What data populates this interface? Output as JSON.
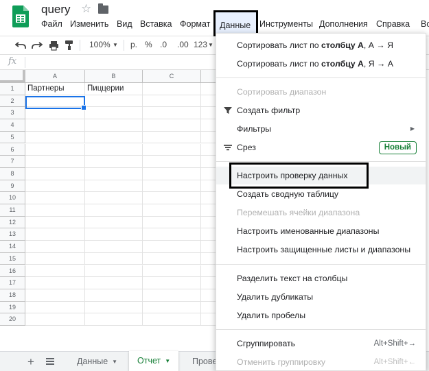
{
  "doc": {
    "title": "query",
    "star_icon": "star-icon",
    "folder_icon": "folder-icon"
  },
  "menubar": {
    "file": "Файл",
    "edit": "Изменить",
    "view": "Вид",
    "insert": "Вставка",
    "format": "Формат",
    "data": "Данные",
    "tools": "Инструменты",
    "addons": "Дополнения",
    "help": "Справка",
    "edge": "Вс"
  },
  "toolbar": {
    "zoom": "100%",
    "currency": "р.",
    "percent": "%",
    "dec_decrease": ".0",
    "dec_increase": ".00",
    "more_formats": "123"
  },
  "formula": {
    "fx": "fx"
  },
  "grid": {
    "columns": [
      "A",
      "B",
      "C"
    ],
    "rows": [
      "1",
      "2",
      "3",
      "4",
      "5",
      "6",
      "7",
      "8",
      "9",
      "10",
      "11",
      "12",
      "13",
      "14",
      "15",
      "16",
      "17",
      "18",
      "19",
      "20"
    ],
    "cells": {
      "A1": "Партнеры",
      "B1": "Пиццерии"
    }
  },
  "sheets": {
    "tabs": [
      {
        "label": "Данные",
        "active": false
      },
      {
        "label": "Отчет",
        "active": true
      },
      {
        "label": "Прове",
        "active": false
      }
    ]
  },
  "data_menu": {
    "sort_a_z_pre": "Сортировать лист по ",
    "sort_a_z_bold": "столбцу А",
    "sort_a_z_post": ", А → Я",
    "sort_z_a_pre": "Сортировать лист по ",
    "sort_z_a_bold": "столбцу А",
    "sort_z_a_post": ", Я → А",
    "sort_range": "Сортировать диапазон",
    "create_filter": "Создать фильтр",
    "filters": "Фильтры",
    "slicer": "Срез",
    "new_badge": "Новый",
    "data_validation": "Настроить проверку данных",
    "pivot_table": "Создать сводную таблицу",
    "randomize": "Перемешать ячейки диапазона",
    "named_ranges": "Настроить именованные диапазоны",
    "protected": "Настроить защищенные листы и диапазоны",
    "split_text": "Разделить текст на столбцы",
    "remove_duplicates": "Удалить дубликаты",
    "trim_whitespace": "Удалить пробелы",
    "group": "Сгруппировать",
    "group_shortcut": "Alt+Shift+→",
    "ungroup": "Отменить группировку",
    "ungroup_shortcut": "Alt+Shift+←"
  },
  "colors": {
    "accent": "#1a73e8",
    "sheets_green": "#188038"
  }
}
